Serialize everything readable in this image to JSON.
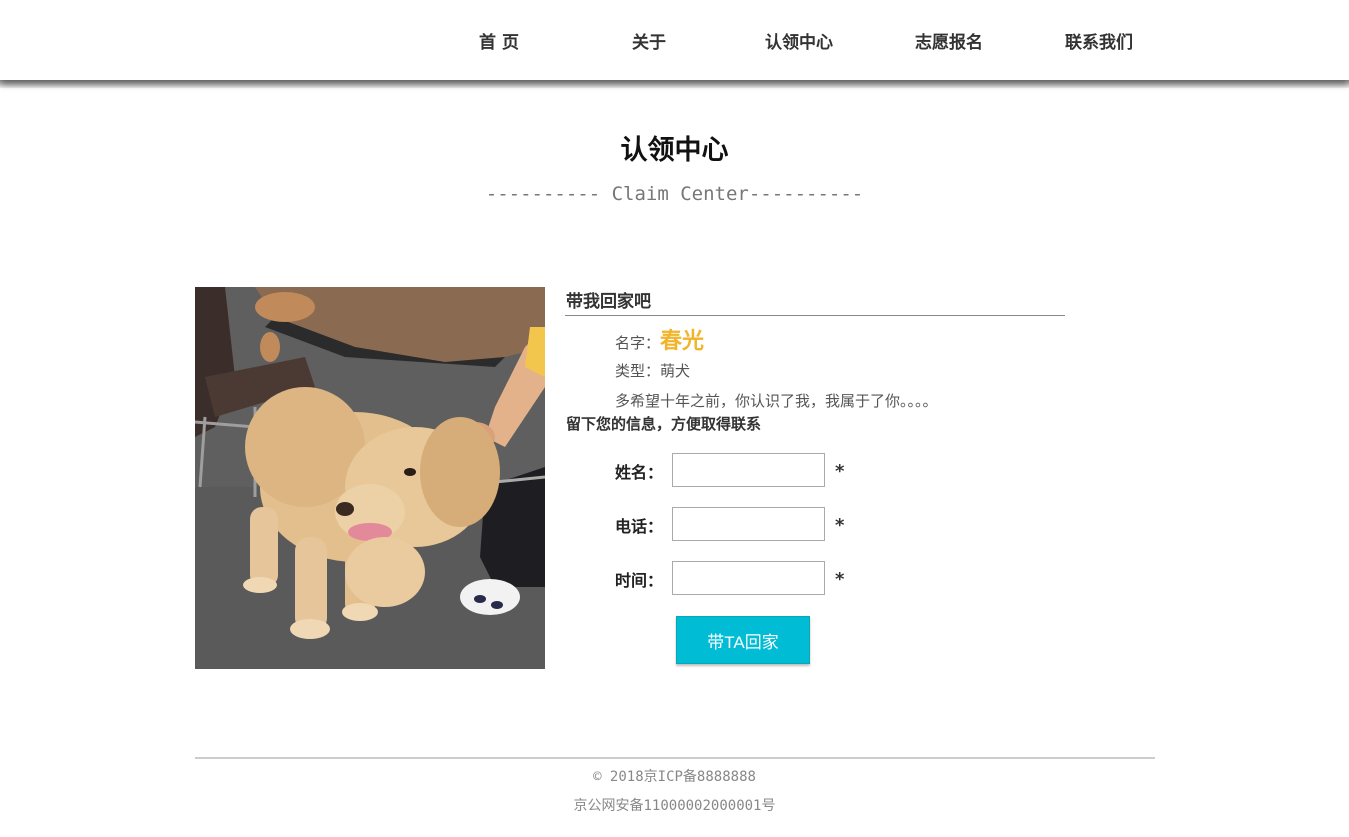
{
  "nav": {
    "items": [
      {
        "label": "首 页"
      },
      {
        "label": "关于"
      },
      {
        "label": "认领中心"
      },
      {
        "label": "志愿报名"
      },
      {
        "label": "联系我们"
      }
    ]
  },
  "page": {
    "title": "认领中心",
    "subtitle": "---------- Claim Center----------"
  },
  "pet": {
    "heading": "带我回家吧",
    "name_label": "名字：",
    "name_value": "春光",
    "type_line": "类型：萌犬",
    "desc_line": "多希望十年之前，你认识了我，我属于了你。。。。",
    "photo_name": "golden-retriever-photo"
  },
  "form": {
    "title": "留下您的信息，方便取得联系",
    "fields": [
      {
        "label": "姓名：",
        "value": "",
        "required_mark": "*"
      },
      {
        "label": "电话：",
        "value": "",
        "required_mark": "*"
      },
      {
        "label": "时间：",
        "value": "",
        "required_mark": "*"
      }
    ],
    "submit_label": "带TA回家"
  },
  "footer": {
    "copyright": "© 2018京ICP备8888888",
    "police": "京公网安备11000002000001号"
  },
  "colors": {
    "accent_button": "#00bcd4",
    "pet_name": "#f0b52b"
  }
}
